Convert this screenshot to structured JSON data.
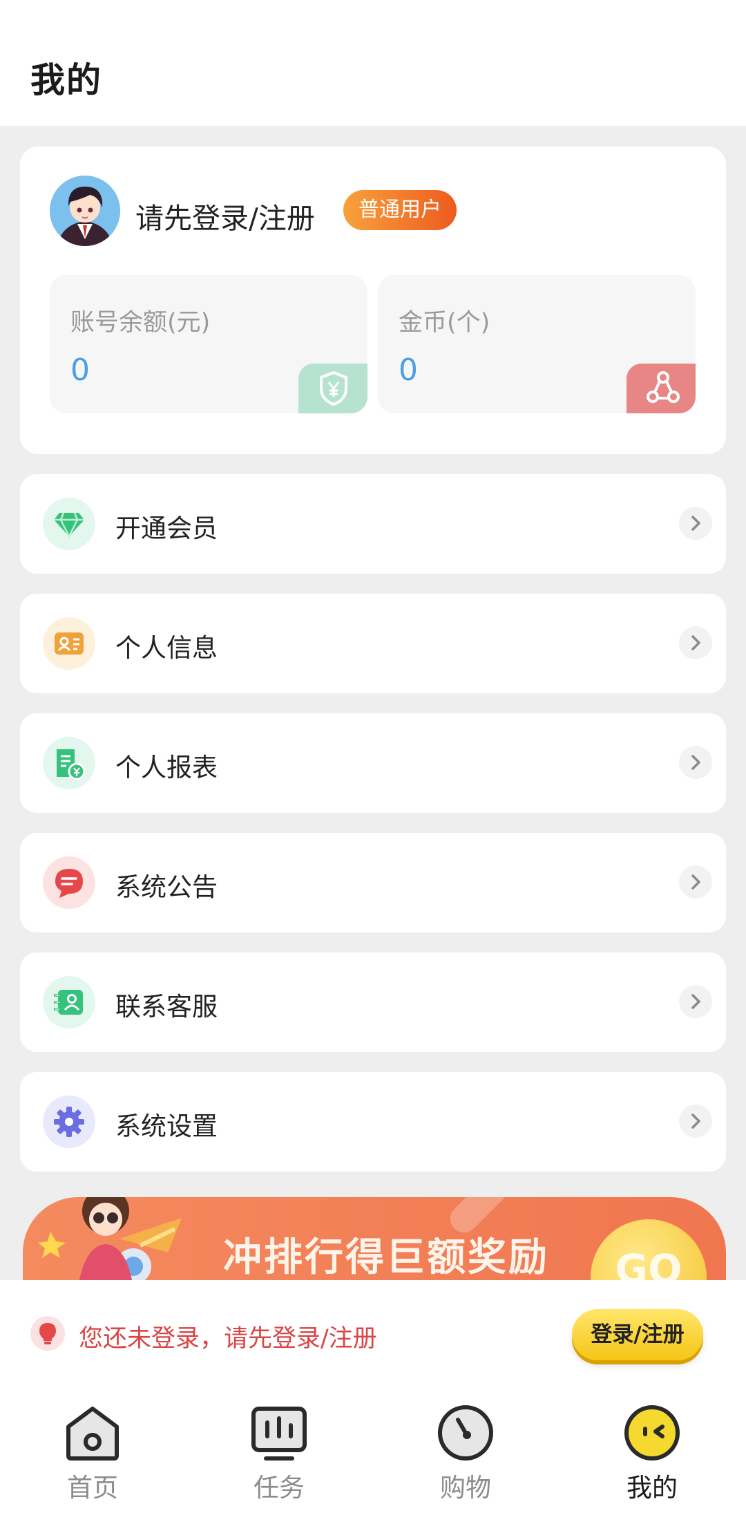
{
  "header": {
    "title": "我的"
  },
  "profile": {
    "login_prompt": "请先登录/注册",
    "user_badge": "普通用户",
    "balance": {
      "label": "账号余额(元)",
      "value": "0"
    },
    "coins": {
      "label": "金币(个)",
      "value": "0"
    }
  },
  "menu": [
    {
      "label": "开通会员",
      "icon": "diamond-icon"
    },
    {
      "label": "个人信息",
      "icon": "id-card-icon"
    },
    {
      "label": "个人报表",
      "icon": "report-icon"
    },
    {
      "label": "系统公告",
      "icon": "message-icon"
    },
    {
      "label": "联系客服",
      "icon": "contact-icon"
    },
    {
      "label": "系统设置",
      "icon": "gear-icon"
    }
  ],
  "banner": {
    "text": "冲排行得巨额奖励",
    "go": "GO"
  },
  "notice": {
    "text": "您还未登录，请先登录/注册",
    "button": "登录/注册"
  },
  "nav": [
    {
      "label": "首页",
      "icon": "home-icon"
    },
    {
      "label": "任务",
      "icon": "task-icon"
    },
    {
      "label": "购物",
      "icon": "shopping-icon"
    },
    {
      "label": "我的",
      "icon": "mine-icon",
      "active": true
    }
  ],
  "colors": {
    "accent_yellow": "#f6c516",
    "badge_orange": "#ef5a1f",
    "value_blue": "#4a9ee8",
    "notice_red": "#d94545"
  }
}
